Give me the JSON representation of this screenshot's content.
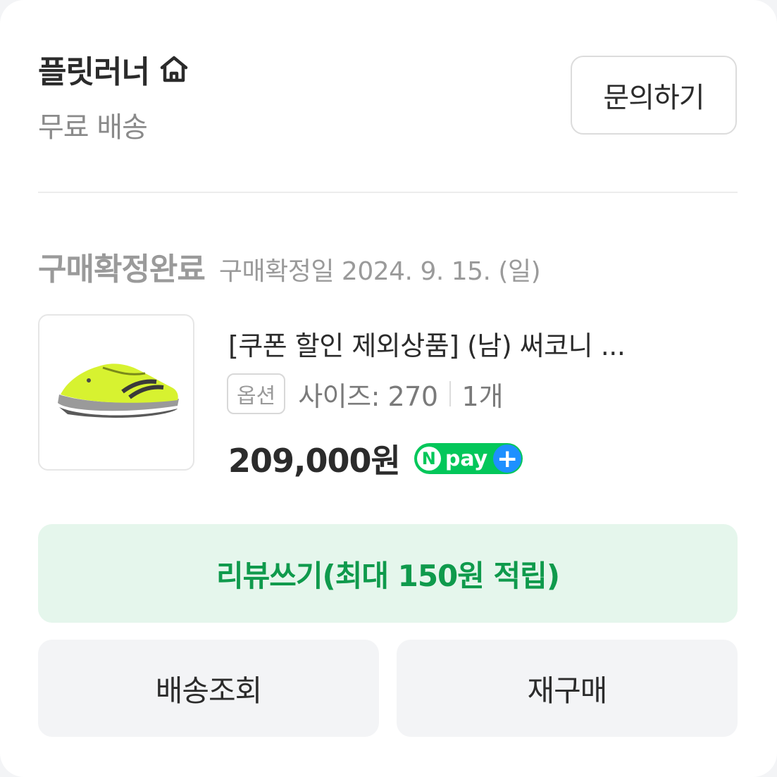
{
  "seller": {
    "name": "플릿러너",
    "shipping": "무료 배송",
    "inquiry_label": "문의하기"
  },
  "order": {
    "status": "구매확정완료",
    "confirm_date": "구매확정일 2024. 9. 15. (일)"
  },
  "product": {
    "title": "[쿠폰 할인 제외상품] (남) 써코니 ...",
    "option_badge": "옵션",
    "size": "사이즈: 270",
    "quantity": "1개",
    "price": "209,000원",
    "pay_badge": {
      "n_letter": "N",
      "text": "pay",
      "plus": "+"
    }
  },
  "actions": {
    "review_label": "리뷰쓰기(최대 150원 적립)",
    "track_label": "배송조회",
    "reorder_label": "재구매"
  },
  "colors": {
    "accent_green": "#0f9a4c",
    "review_bg": "#e5f6ec",
    "npay_green": "#03c75a",
    "npay_blue": "#1e90ff"
  },
  "icons": {
    "seller_home": "home-icon",
    "product_image": "running-shoe-thumbnail"
  }
}
